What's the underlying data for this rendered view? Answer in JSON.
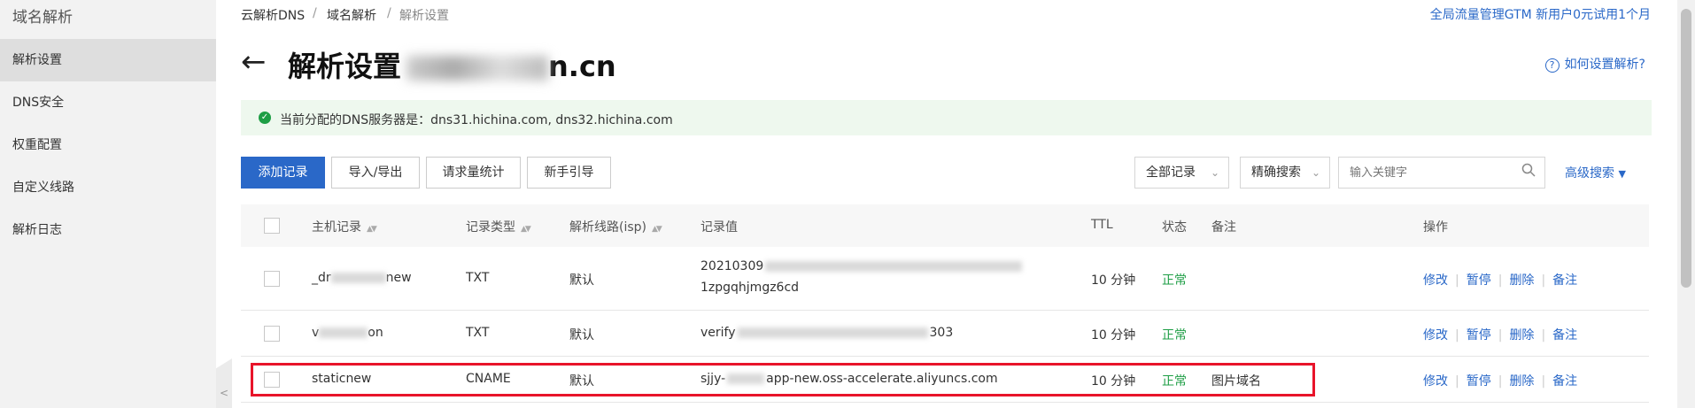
{
  "sidebar": {
    "title": "域名解析",
    "items": [
      {
        "label": "解析设置",
        "active": true
      },
      {
        "label": "DNS安全"
      },
      {
        "label": "权重配置"
      },
      {
        "label": "自定义线路"
      },
      {
        "label": "解析日志"
      }
    ]
  },
  "breadcrumb": [
    "云解析DNS",
    "/",
    "域名解析",
    "/",
    "解析设置"
  ],
  "promo": "全局流量管理GTM 新用户0元试用1个月",
  "page": {
    "title": "解析设置",
    "domain_suffix": "n.cn",
    "help": "如何设置解析?"
  },
  "notice": "当前分配的DNS服务器是：dns31.hichina.com, dns32.hichina.com",
  "toolbar": {
    "add": "添加记录",
    "import": "导入/导出",
    "stats": "请求量统计",
    "guide": "新手引导",
    "filter": "全部记录",
    "search_mode": "精确搜索",
    "search_placeholder": "输入关键字",
    "advanced": "高级搜索"
  },
  "table": {
    "headers": {
      "host": "主机记录",
      "type": "记录类型",
      "line": "解析线路(isp)",
      "value": "记录值",
      "ttl": "TTL",
      "status": "状态",
      "remark": "备注",
      "ops": "操作"
    },
    "rows": [
      {
        "host_a": "_dr",
        "host_b": "new",
        "type": "TXT",
        "line": "默认",
        "value_a": "20210309",
        "value_b": "1zpgqhjmgz6cd",
        "ttl": "10 分钟",
        "status": "正常",
        "remark": ""
      },
      {
        "host_a": "v",
        "host_b": "on",
        "type": "TXT",
        "line": "默认",
        "value_a": "verify",
        "value_b": "303",
        "ttl": "10 分钟",
        "status": "正常",
        "remark": ""
      },
      {
        "host_a": "staticnew",
        "type": "CNAME",
        "line": "默认",
        "value_a": "sjjy-",
        "value_b": "app-new.oss-accelerate.aliyuncs.com",
        "ttl": "10 分钟",
        "status": "正常",
        "remark": "图片域名"
      }
    ],
    "ops": [
      "修改",
      "暂停",
      "删除",
      "备注"
    ]
  },
  "colors": {
    "accent": "#2a68c8",
    "ok": "#1e9e45",
    "highlight": "#e8142a"
  }
}
